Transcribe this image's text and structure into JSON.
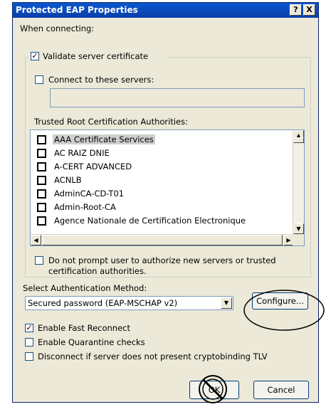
{
  "title": "Protected EAP Properties",
  "title_buttons": {
    "help": "?",
    "close": "X"
  },
  "when_connecting_label": "When connecting:",
  "validate_checkbox": {
    "label": "Validate server certificate",
    "checked": true
  },
  "connect_servers_checkbox": {
    "label": "Connect to these servers:",
    "checked": false
  },
  "servers_field_value": "",
  "trusted_label": "Trusted Root Certification Authorities:",
  "authorities": [
    {
      "name": "AAA Certificate Services",
      "selected": true
    },
    {
      "name": "AC RAIZ DNIE"
    },
    {
      "name": "A-CERT ADVANCED"
    },
    {
      "name": "ACNLB"
    },
    {
      "name": "AdminCA-CD-T01"
    },
    {
      "name": "Admin-Root-CA"
    },
    {
      "name": "Agence Nationale de Certification Electronique"
    }
  ],
  "do_not_prompt": {
    "line1": "Do not prompt user to authorize new servers or trusted",
    "line2": "certification authorities.",
    "checked": false
  },
  "auth_method_label": "Select Authentication Method:",
  "auth_method_value": "Secured password (EAP-MSCHAP v2)",
  "configure_button": "Configure...",
  "options": [
    {
      "label": "Enable Fast Reconnect",
      "checked": true
    },
    {
      "label": "Enable Quarantine checks",
      "checked": false
    },
    {
      "label": "Disconnect if server does not present cryptobinding TLV",
      "checked": false
    }
  ],
  "ok_button": "OK",
  "cancel_button": "Cancel",
  "annotation_color": "#000000",
  "icons": {
    "scroll_up": "▲",
    "scroll_down": "▼",
    "scroll_left": "◀",
    "scroll_right": "▶",
    "dropdown": "▼",
    "check": "✓"
  }
}
